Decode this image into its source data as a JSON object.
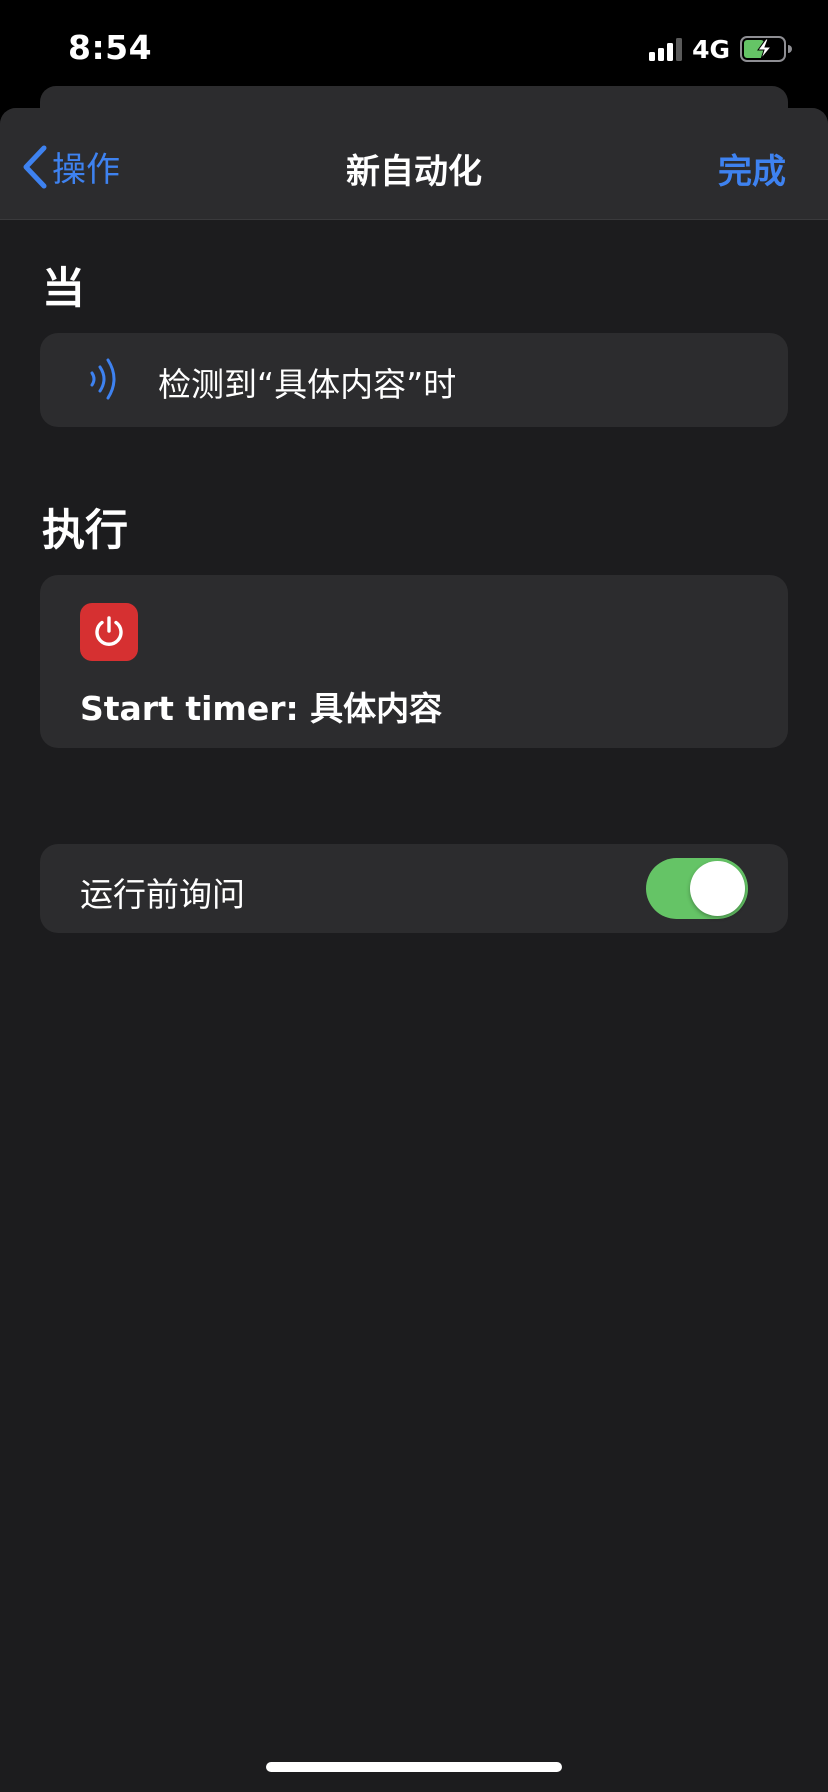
{
  "status_bar": {
    "time": "8:54",
    "network": "4G"
  },
  "nav": {
    "back_label": "操作",
    "title": "新自动化",
    "done_label": "完成"
  },
  "when_section": {
    "title": "当",
    "trigger_text": "检测到“具体内容”时",
    "trigger_icon": "nfc-waves-icon"
  },
  "do_section": {
    "title": "执行",
    "action_icon": "power-icon",
    "action_icon_color": "#d63031",
    "action_text": "Start timer: 具体内容"
  },
  "ask_before_running": {
    "label": "运行前询问",
    "enabled": true,
    "toggle_color": "#65c466"
  },
  "colors": {
    "accent": "#3e82f0",
    "background": "#1c1c1e",
    "card": "#2c2c2e"
  }
}
